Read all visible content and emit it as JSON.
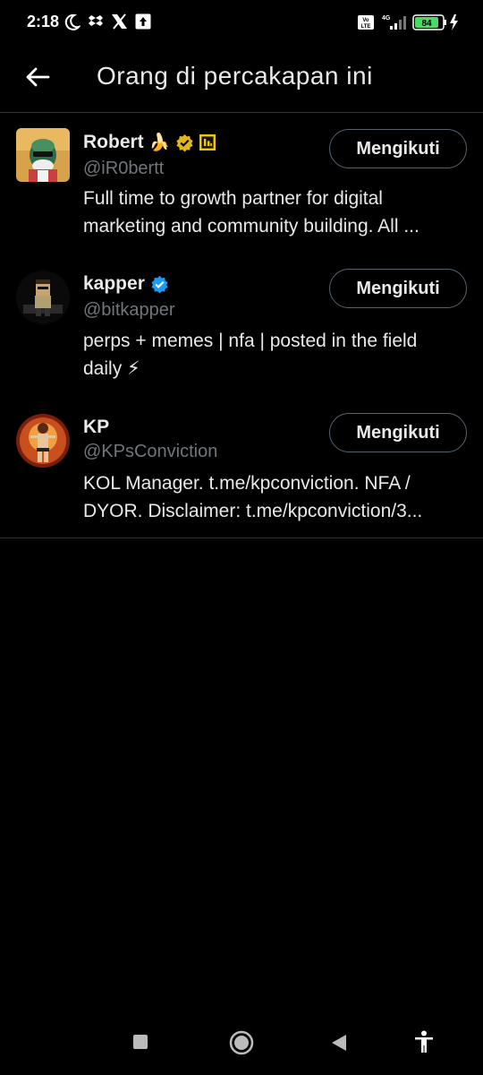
{
  "status_bar": {
    "time": "2:18",
    "network": "4G",
    "volte": "Vo LTE",
    "battery": "84"
  },
  "header": {
    "title": "Orang di percakapan ini"
  },
  "users": [
    {
      "name": "Robert",
      "emoji": "🍌",
      "handle": "@iR0bertt",
      "bio_lines": [
        "Full time to growth partner for digital",
        "marketing and community building. All ..."
      ],
      "button": "Mengikuti",
      "badge": "gold-verified"
    },
    {
      "name": "kapper",
      "handle": "@bitkapper",
      "bio_lines": [
        "perps + memes | nfa | posted in the field",
        "daily ⚡"
      ],
      "button": "Mengikuti",
      "badge": "blue-verified"
    },
    {
      "name": "KP",
      "handle": "@KPsConviction",
      "bio_lines": [
        "KOL Manager. t.me/kpconviction. NFA /",
        "DYOR. Disclaimer: t.me/kpconviction/3..."
      ],
      "button": "Mengikuti",
      "badge": "none"
    }
  ],
  "colors": {
    "background": "#000000",
    "text": "#e7e9ea",
    "muted": "#71767b",
    "border": "#2f3336",
    "verified_blue": "#1d9bf0",
    "verified_gold": "#e2b719"
  }
}
